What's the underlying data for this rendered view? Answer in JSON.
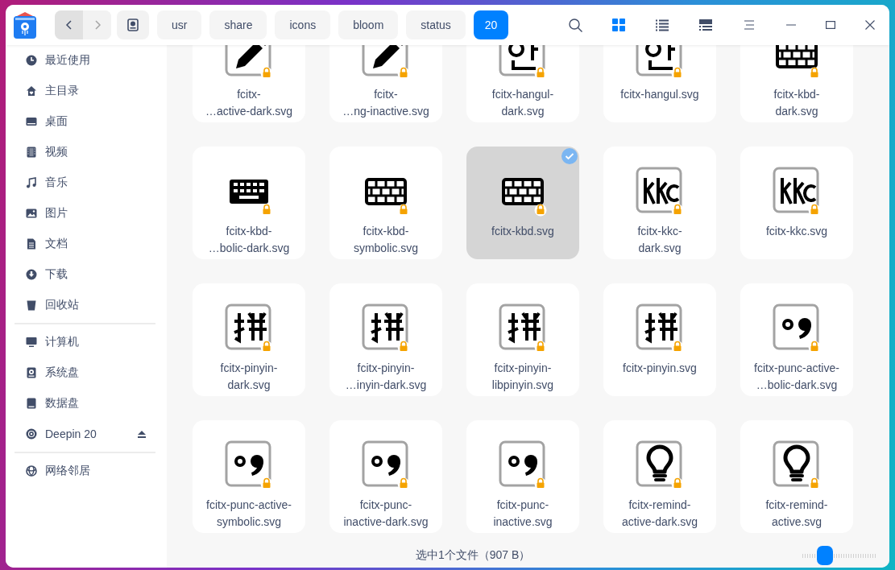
{
  "titlebar": {
    "nav": [
      {
        "kind": "back",
        "disabled": false
      },
      {
        "kind": "forward",
        "disabled": true
      }
    ],
    "breadcrumbs": [
      {
        "label": "usr",
        "selected": false
      },
      {
        "label": "share",
        "selected": false
      },
      {
        "label": "icons",
        "selected": false
      },
      {
        "label": "bloom",
        "selected": false
      },
      {
        "label": "status",
        "selected": false
      },
      {
        "label": "20",
        "selected": true
      }
    ],
    "views": [
      {
        "kind": "icon",
        "selected": true
      },
      {
        "kind": "list",
        "selected": false
      },
      {
        "kind": "tree",
        "selected": false
      }
    ]
  },
  "sidebar": {
    "groups": [
      {
        "items": [
          {
            "label": "最近使用",
            "kind": "clock"
          },
          {
            "label": "主目录",
            "kind": "home"
          },
          {
            "label": "桌面",
            "kind": "desktop"
          },
          {
            "label": "视频",
            "kind": "video"
          },
          {
            "label": "音乐",
            "kind": "music"
          },
          {
            "label": "图片",
            "kind": "picture"
          },
          {
            "label": "文档",
            "kind": "document"
          },
          {
            "label": "下载",
            "kind": "download"
          },
          {
            "label": "回收站",
            "kind": "trash"
          }
        ]
      },
      {
        "items": [
          {
            "label": "计算机",
            "kind": "computer"
          },
          {
            "label": "系统盘",
            "kind": "system-disk"
          },
          {
            "label": "数据盘",
            "kind": "disk"
          },
          {
            "label": "Deepin 20",
            "kind": "optical",
            "ejectable": true
          }
        ]
      },
      {
        "items": [
          {
            "label": "网络邻居",
            "kind": "network"
          }
        ]
      }
    ]
  },
  "files": [
    {
      "name": "fcitx-\n…active-dark.svg",
      "kind": "pencil",
      "selected": false
    },
    {
      "name": "fcitx-\n…ng-inactive.svg",
      "kind": "pencil",
      "selected": false
    },
    {
      "name": "fcitx-hangul-\ndark.svg",
      "kind": "hangul",
      "selected": false
    },
    {
      "name": "fcitx-hangul.svg",
      "kind": "hangul",
      "selected": false
    },
    {
      "name": "fcitx-kbd-\ndark.svg",
      "kind": "keyboard",
      "selected": false
    },
    {
      "name": "fcitx-kbd-\n…bolic-dark.svg",
      "kind": "keyboard-solid",
      "selected": false
    },
    {
      "name": "fcitx-kbd-\nsymbolic.svg",
      "kind": "keyboard",
      "selected": false
    },
    {
      "name": "fcitx-kbd.svg",
      "kind": "keyboard",
      "selected": true
    },
    {
      "name": "fcitx-kkc-\ndark.svg",
      "kind": "kkc",
      "selected": false
    },
    {
      "name": "fcitx-kkc.svg",
      "kind": "kkc",
      "selected": false
    },
    {
      "name": "fcitx-pinyin-\ndark.svg",
      "kind": "pinyin",
      "selected": false
    },
    {
      "name": "fcitx-pinyin-\n…inyin-dark.svg",
      "kind": "pinyin",
      "selected": false
    },
    {
      "name": "fcitx-pinyin-\nlibpinyin.svg",
      "kind": "pinyin",
      "selected": false
    },
    {
      "name": "fcitx-pinyin.svg",
      "kind": "pinyin",
      "selected": false
    },
    {
      "name": "fcitx-punc-active-\n…bolic-dark.svg",
      "kind": "punc",
      "selected": false
    },
    {
      "name": "fcitx-punc-active-\nsymbolic.svg",
      "kind": "punc",
      "selected": false
    },
    {
      "name": "fcitx-punc-\ninactive-dark.svg",
      "kind": "punc",
      "selected": false
    },
    {
      "name": "fcitx-punc-\ninactive.svg",
      "kind": "punc",
      "selected": false
    },
    {
      "name": "fcitx-remind-\nactive-dark.svg",
      "kind": "bulb",
      "selected": false
    },
    {
      "name": "fcitx-remind-\nactive.svg",
      "kind": "bulb",
      "selected": false
    }
  ],
  "status_bar": {
    "text": "选中1个文件（907 B）",
    "zoom": {
      "level": 0.25
    }
  }
}
